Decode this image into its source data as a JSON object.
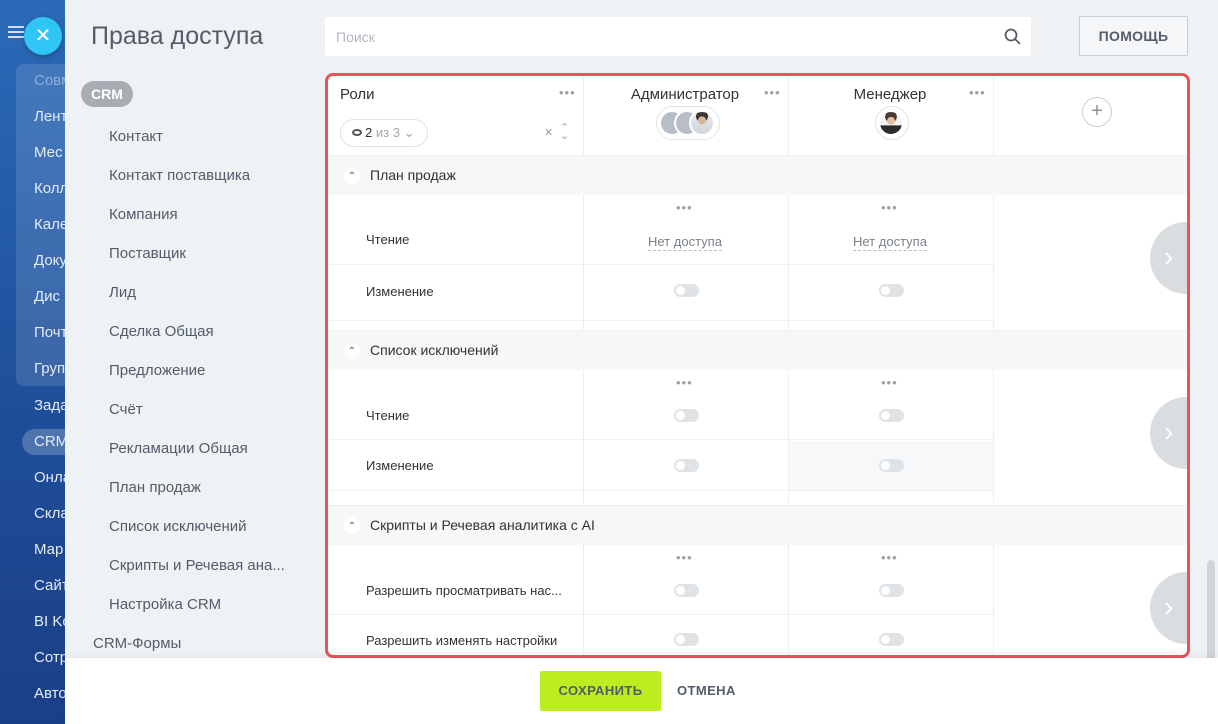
{
  "background_nav": {
    "items": [
      "Совм",
      "Лент",
      "Мес",
      "Колл",
      "Кале",
      "Доку",
      "Дис",
      "Почт",
      "Груп",
      "Зада",
      "CRM",
      "Онла",
      "Скла",
      "Мар",
      "Сайт",
      "BI Ko",
      "Сотр",
      "Авто"
    ]
  },
  "header": {
    "title": "Права доступа",
    "search_placeholder": "Поиск",
    "help_label": "ПОМОЩЬ"
  },
  "sidebar": {
    "pill": "CRM",
    "items": [
      "Контакт",
      "Контакт поставщика",
      "Компания",
      "Поставщик",
      "Лид",
      "Сделка Общая",
      "Предложение",
      "Счёт",
      "Рекламации Общая",
      "План продаж",
      "Список исключений",
      "Скрипты и Речевая ана...",
      "Настройка CRM"
    ],
    "bottom_item": "CRM-Формы"
  },
  "table": {
    "roles_label": "Роли",
    "counter": {
      "shown": "2",
      "of": "из 3"
    },
    "columns": [
      {
        "name": "Администратор"
      },
      {
        "name": "Менеджер"
      }
    ],
    "sections": [
      {
        "title": "План продаж",
        "rows": [
          {
            "label": "Чтение",
            "values": [
              "Нет доступа",
              "Нет доступа"
            ]
          },
          {
            "label": "Изменение",
            "values": [
              "",
              ""
            ]
          }
        ]
      },
      {
        "title": "Список исключений",
        "rows": [
          {
            "label": "Чтение",
            "values": [
              "",
              ""
            ]
          },
          {
            "label": "Изменение",
            "values": [
              "",
              ""
            ]
          }
        ]
      },
      {
        "title": "Скрипты и Речевая аналитика с AI",
        "rows": [
          {
            "label": "Разрешить просматривать нас...",
            "values": [
              "",
              ""
            ]
          },
          {
            "label": "Разрешить изменять настройки",
            "values": [
              "",
              ""
            ]
          }
        ]
      }
    ]
  },
  "footer": {
    "save_label": "СОХРАНИТЬ",
    "cancel_label": "ОТМЕНА"
  },
  "colors": {
    "accent_green": "#bbed21",
    "highlight_red": "#e8525a",
    "close_blue": "#2fc6f6"
  }
}
